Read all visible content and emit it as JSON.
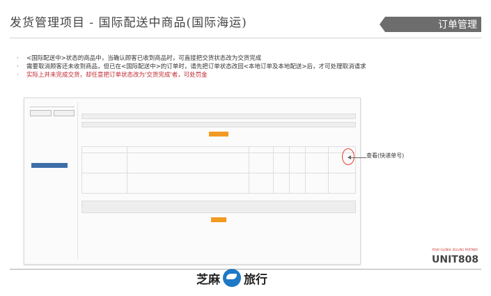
{
  "header": {
    "title": "发货管理项目 - 国际配送中商品(国际海运)",
    "section_badge": "订单管理"
  },
  "notes": [
    {
      "text": "<国际配送中>状态的商品中，当确认顾客已收到商品时，可直接把交货状态改为交货完成",
      "color": "#333333"
    },
    {
      "text": "需要取消顾客还未收到商品，但已在<国际配送中>的订单时，请先把订单状态改回<本地订单及本地配送>后，才可处理取消请求",
      "color": "#333333"
    },
    {
      "text": "实际上并未完成交货，却任意把订单状态改为'交货完成'者，可处罚金",
      "color": "#c0262d"
    }
  ],
  "callout": {
    "label": "查看(快递单号)"
  },
  "footer": {
    "brand_text_left": "芝麻",
    "brand_text_right": "旅行",
    "partner_logo": "UNIT808",
    "partner_logo_tagline": "YOUR GLOBAL SELLING PARTNER"
  },
  "colors": {
    "accent_red": "#c0262d",
    "badge_gray": "#6d6d6d",
    "brand_blue": "#1d79c5",
    "action_orange": "#f39a21"
  },
  "icons": [
    "globe-plane-icon",
    "arrow-left-icon"
  ]
}
